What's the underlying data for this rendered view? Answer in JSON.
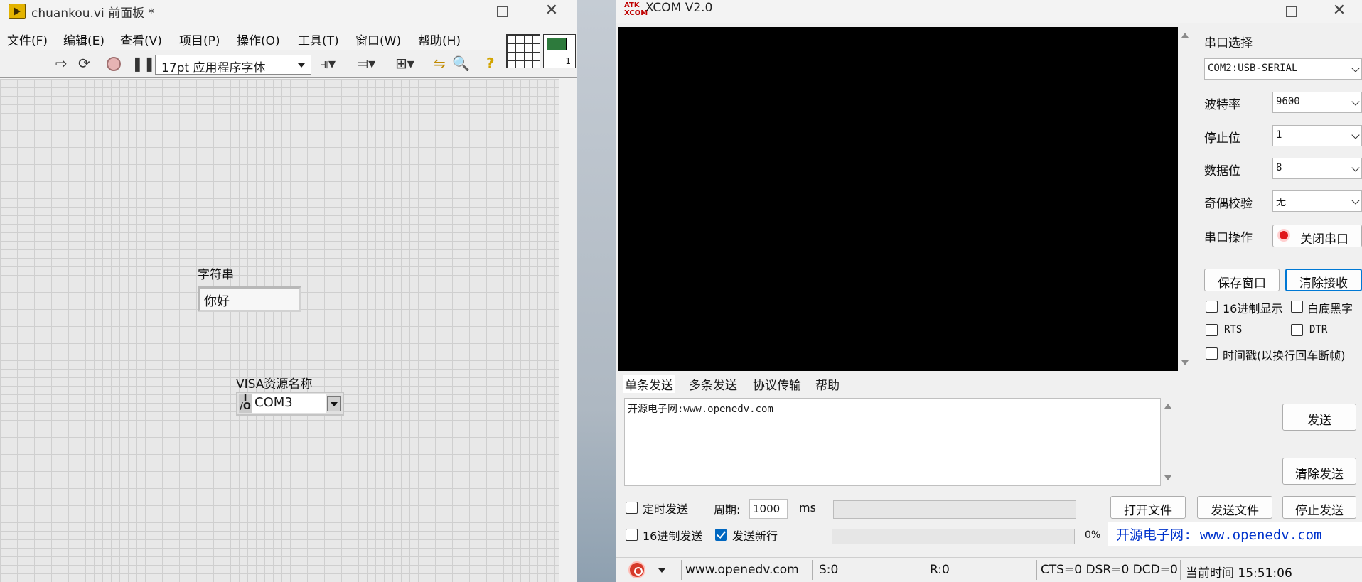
{
  "labview": {
    "title": "chuankou.vi 前面板 *",
    "menu": [
      "文件(F)",
      "编辑(E)",
      "查看(V)",
      "项目(P)",
      "操作(O)",
      "工具(T)",
      "窗口(W)",
      "帮助(H)"
    ],
    "font_selector": "17pt 应用程序字体",
    "string_control": {
      "label": "字符串",
      "value": "你好"
    },
    "visa_control": {
      "label": "VISA资源名称",
      "value": "COM3",
      "io_glyph": "I/O"
    },
    "icon_number": "1"
  },
  "xcom": {
    "title": "XCOM V2.0",
    "logo_text": "ATK XCOM",
    "settings": {
      "port_label": "串口选择",
      "port_value": "COM2:USB-SERIAL",
      "baud_label": "波特率",
      "baud_value": "9600",
      "stop_label": "停止位",
      "stop_value": "1",
      "data_label": "数据位",
      "data_value": "8",
      "parity_label": "奇偶校验",
      "parity_value": "无",
      "op_label": "串口操作",
      "op_button": "关闭串口"
    },
    "buttons": {
      "save_window": "保存窗口",
      "clear_recv": "清除接收",
      "send": "发送",
      "clear_send": "清除发送",
      "open_file": "打开文件",
      "send_file": "发送文件",
      "stop_send": "停止发送"
    },
    "checks": {
      "hex_display": {
        "label": "16进制显示",
        "checked": false
      },
      "white_black": {
        "label": "白底黑字",
        "checked": false
      },
      "rts": {
        "label": "RTS",
        "checked": false
      },
      "dtr": {
        "label": "DTR",
        "checked": false
      },
      "timestamp": {
        "label": "时间戳(以换行回车断帧)",
        "checked": false
      },
      "timed_send": {
        "label": "定时发送",
        "checked": false
      },
      "hex_send": {
        "label": "16进制发送",
        "checked": false
      },
      "send_newline": {
        "label": "发送新行",
        "checked": true
      }
    },
    "tabs": [
      "单条发送",
      "多条发送",
      "协议传输",
      "帮助"
    ],
    "send_text": "开源电子网:www.openedv.com",
    "period_label": "周期:",
    "period_value": "1000",
    "period_unit": "ms",
    "progress_percent": "0%",
    "banner": "开源电子网: www.openedv.com",
    "status": {
      "url": "www.openedv.com",
      "sent": "S:0",
      "recv": "R:0",
      "lines": "CTS=0 DSR=0 DCD=0",
      "time": "当前时间 15:51:06"
    }
  }
}
